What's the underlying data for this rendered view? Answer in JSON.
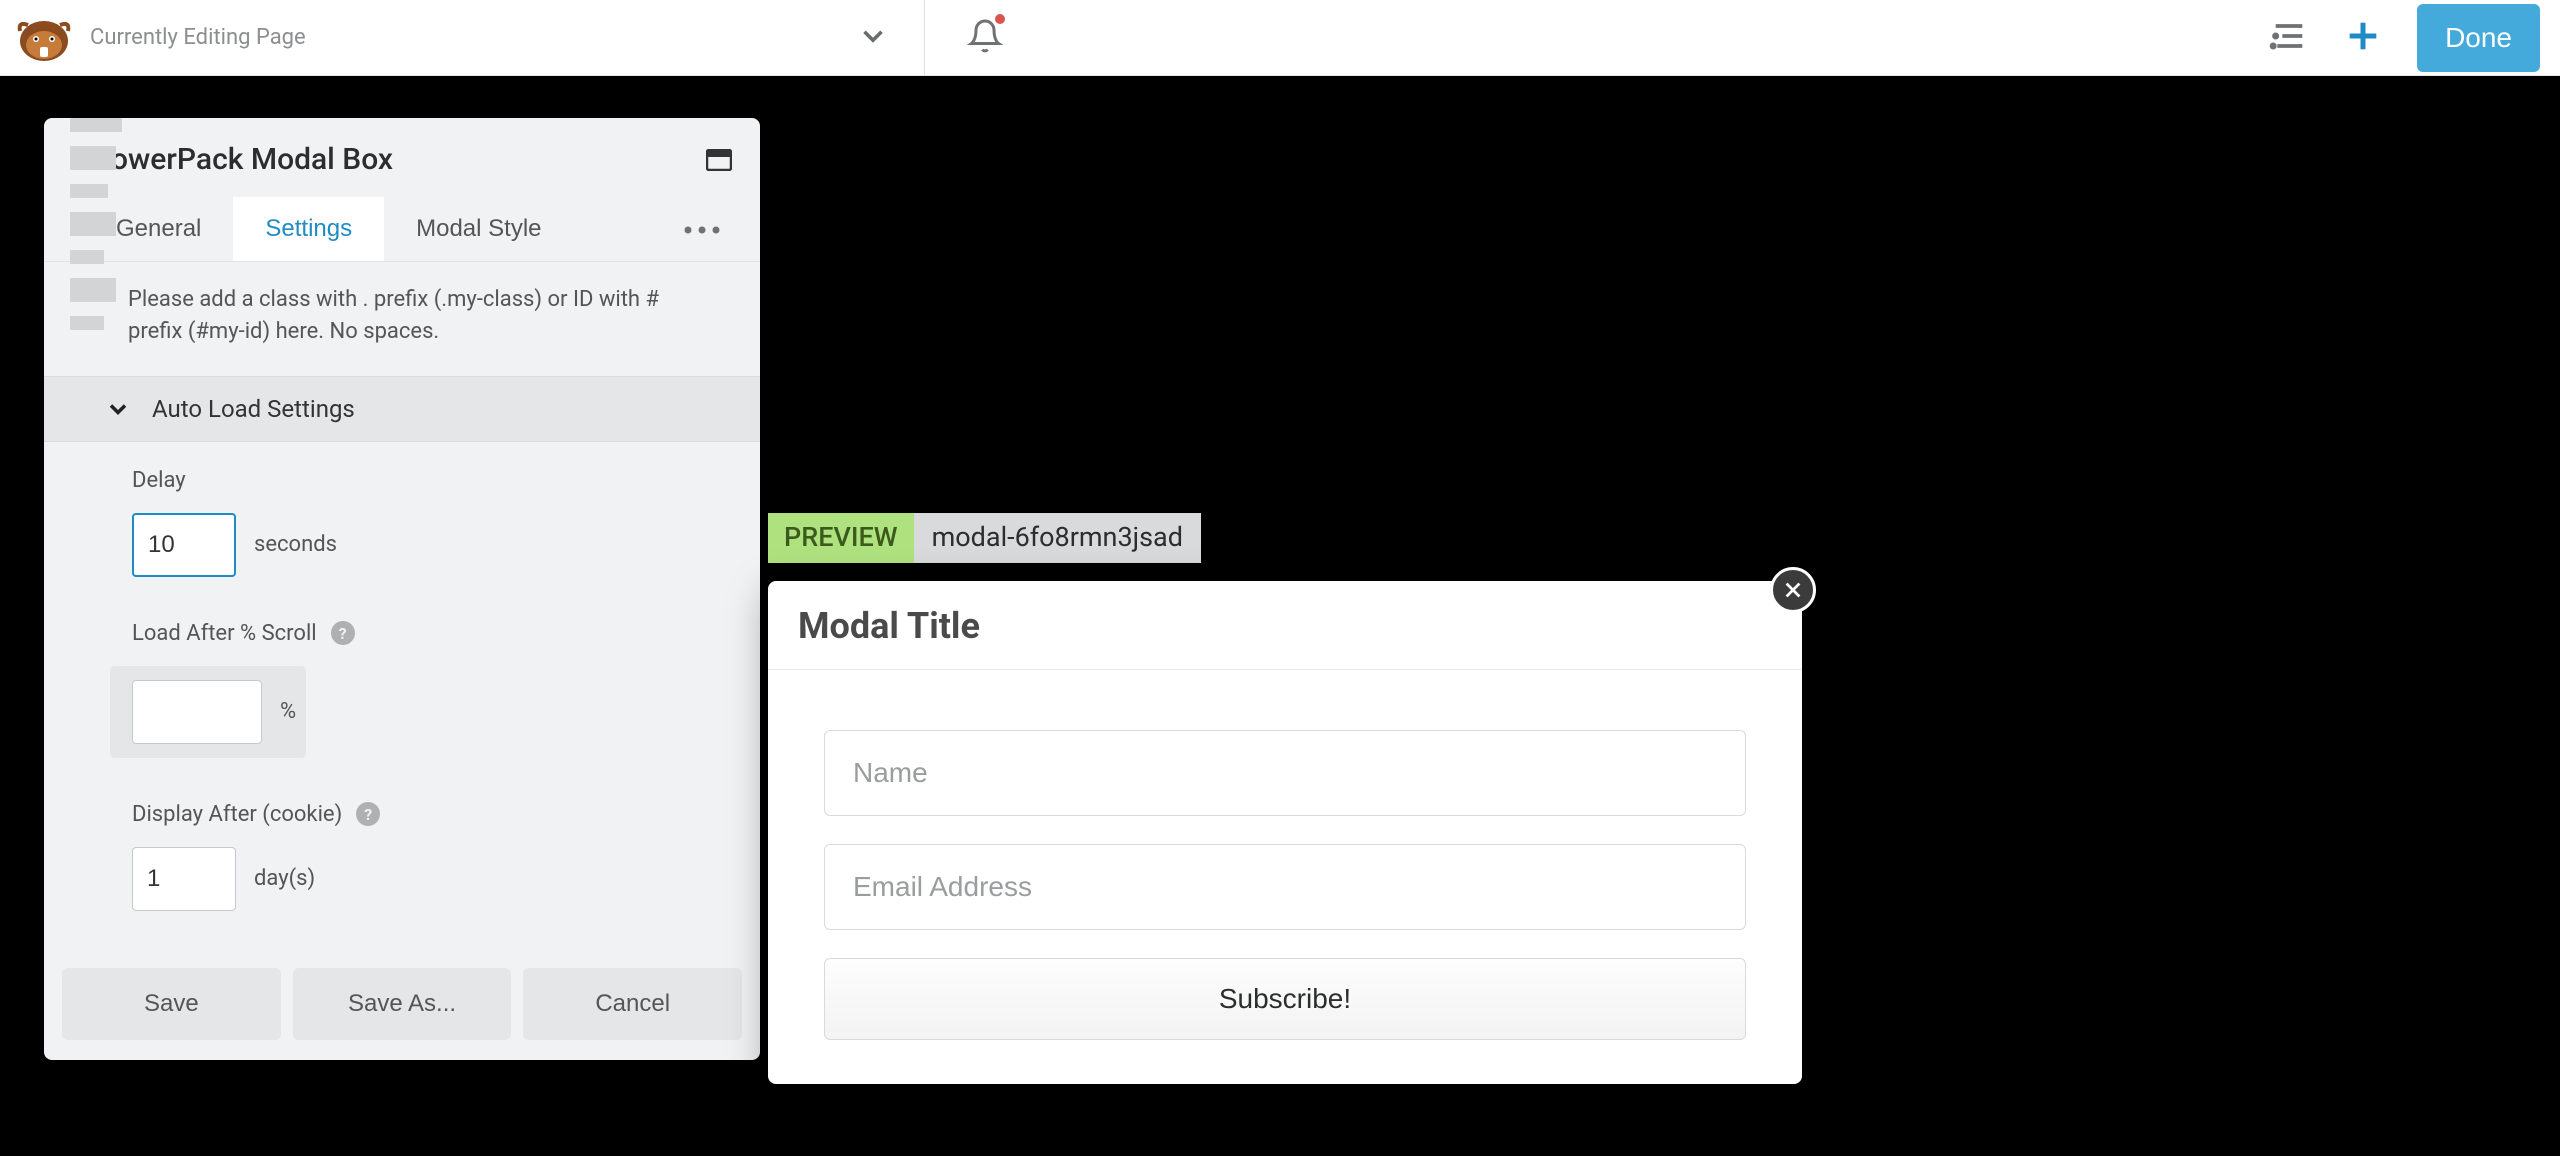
{
  "topbar": {
    "page_title": "Currently Editing Page",
    "done_label": "Done"
  },
  "panel": {
    "title": "PowerPack Modal Box",
    "tabs": {
      "general": "General",
      "settings": "Settings",
      "modal_style": "Modal Style"
    },
    "help_text": "Please add a class with . prefix (.my-class) or ID with # prefix (#my-id) here. No spaces.",
    "section_title": "Auto Load Settings",
    "fields": {
      "delay_label": "Delay",
      "delay_value": "10",
      "delay_unit": "seconds",
      "scroll_label": "Load After % Scroll",
      "scroll_value": "",
      "scroll_unit": "%",
      "cookie_label": "Display After (cookie)",
      "cookie_value": "1",
      "cookie_unit": "day(s)"
    },
    "footer": {
      "save": "Save",
      "save_as": "Save As...",
      "cancel": "Cancel"
    }
  },
  "preview": {
    "label": "PREVIEW",
    "id": "modal-6fo8rmn3jsad"
  },
  "modal": {
    "title": "Modal Title",
    "name_placeholder": "Name",
    "email_placeholder": "Email Address",
    "subscribe_label": "Subscribe!"
  }
}
